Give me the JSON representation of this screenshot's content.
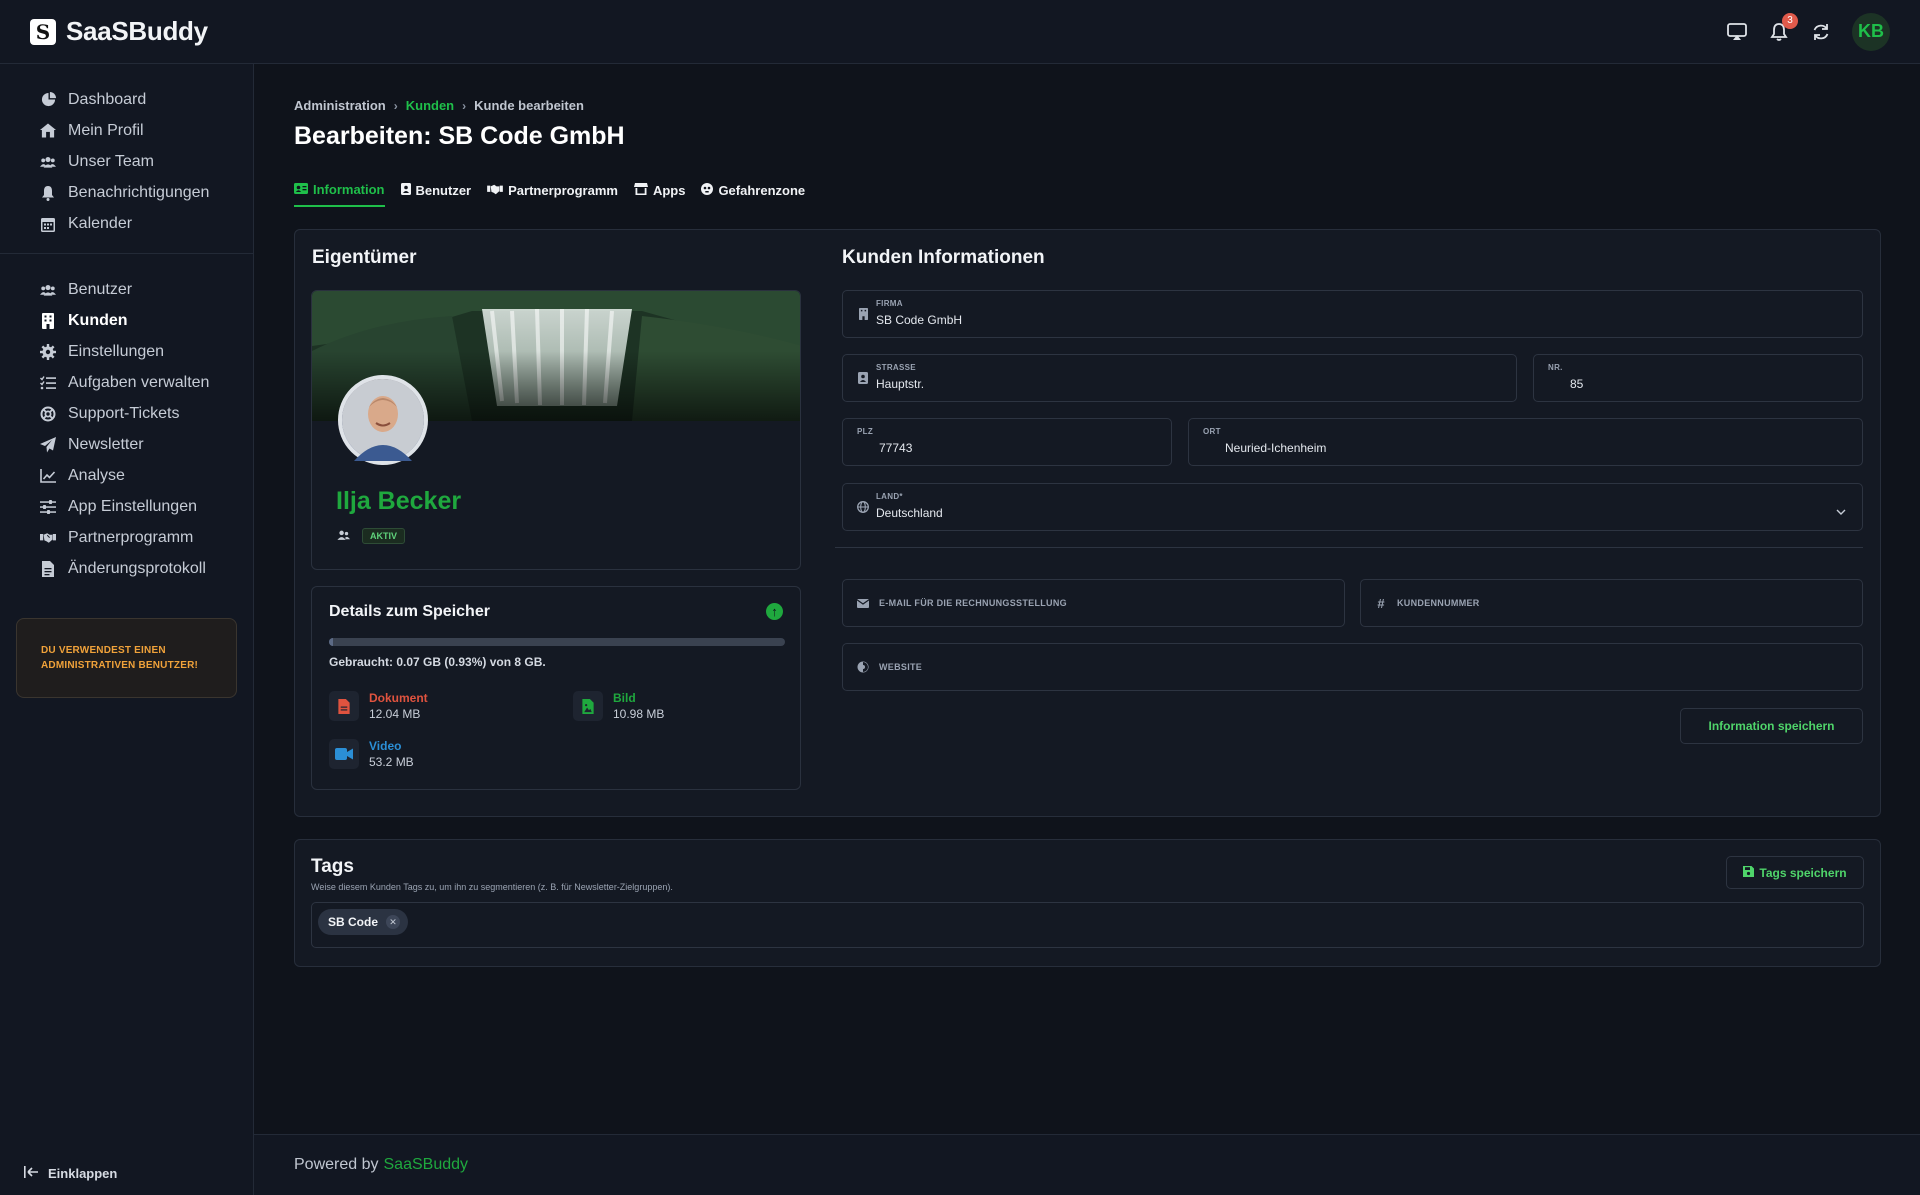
{
  "header": {
    "brand": "SaaSBuddy",
    "brand_logo_letter": "S",
    "notification_count": "3",
    "user_initials": "KB"
  },
  "sidebar": {
    "group1": [
      {
        "label": "Dashboard",
        "icon": "chart-pie-icon"
      },
      {
        "label": "Mein Profil",
        "icon": "home-icon"
      },
      {
        "label": "Unser Team",
        "icon": "users-icon"
      },
      {
        "label": "Benachrichtigungen",
        "icon": "bell-icon"
      },
      {
        "label": "Kalender",
        "icon": "calendar-icon"
      }
    ],
    "group2": [
      {
        "label": "Benutzer",
        "icon": "users-icon"
      },
      {
        "label": "Kunden",
        "icon": "building-icon",
        "active": true
      },
      {
        "label": "Einstellungen",
        "icon": "gear-icon"
      },
      {
        "label": "Aufgaben verwalten",
        "icon": "list-check-icon"
      },
      {
        "label": "Support-Tickets",
        "icon": "lifebuoy-icon"
      },
      {
        "label": "Newsletter",
        "icon": "paper-plane-icon"
      },
      {
        "label": "Analyse",
        "icon": "chart-line-icon"
      },
      {
        "label": "App Einstellungen",
        "icon": "sliders-icon"
      },
      {
        "label": "Partnerprogramm",
        "icon": "handshake-icon"
      },
      {
        "label": "Änderungsprotokoll",
        "icon": "file-icon"
      }
    ],
    "admin_warning": "DU VERWENDEST EINEN ADMINISTRATIVEN BENUTZER!",
    "collapse_label": "Einklappen"
  },
  "breadcrumb": {
    "root": "Administration",
    "middle": "Kunden",
    "current": "Kunde bearbeiten"
  },
  "page_title": "Bearbeiten: SB Code GmbH",
  "tabs": [
    {
      "label": "Information",
      "icon": "id-card-icon",
      "active": true
    },
    {
      "label": "Benutzer",
      "icon": "user-card-icon"
    },
    {
      "label": "Partnerprogramm",
      "icon": "handshake-icon"
    },
    {
      "label": "Apps",
      "icon": "store-icon"
    },
    {
      "label": "Gefahrenzone",
      "icon": "skull-icon"
    }
  ],
  "owner": {
    "section_title": "Eigentümer",
    "name": "Ilja Becker",
    "status": "AKTIV"
  },
  "storage": {
    "title": "Details zum Speicher",
    "used_text": "Gebraucht: 0.07 GB (0.93%) von 8 GB.",
    "used_fraction": 0.0093,
    "files": [
      {
        "label": "Dokument",
        "size": "12.04 MB",
        "color": "#e0533f",
        "icon": "file-icon"
      },
      {
        "label": "Bild",
        "size": "10.98 MB",
        "color": "#1fa83e",
        "icon": "image-file-icon"
      },
      {
        "label": "Video",
        "size": "53.2 MB",
        "color": "#2b8fd6",
        "icon": "video-icon"
      }
    ]
  },
  "customer": {
    "section_title": "Kunden Informationen",
    "firma_label": "FIRMA",
    "firma_value": "SB Code GmbH",
    "strasse_label": "STRASSE",
    "strasse_value": "Hauptstr.",
    "nr_label": "NR.",
    "nr_value": "85",
    "plz_label": "PLZ",
    "plz_value": "77743",
    "ort_label": "ORT",
    "ort_value": "Neuried-Ichenheim",
    "land_label": "LAND*",
    "land_value": "Deutschland",
    "email_label": "E-MAIL FÜR DIE RECHNUNGSSTELLUNG",
    "kundennr_label": "KUNDENNUMMER",
    "website_label": "WEBSITE",
    "save_button": "Information speichern"
  },
  "tags": {
    "title": "Tags",
    "subtitle": "Weise diesem Kunden Tags zu, um ihn zu segmentieren (z. B. für Newsletter-Zielgruppen).",
    "save_button": "Tags speichern",
    "items": [
      "SB Code"
    ]
  },
  "footer": {
    "prefix": "Powered by",
    "brand": "SaaSBuddy"
  },
  "colors": {
    "accent": "#1fbf4a",
    "background": "#0f131b",
    "warning": "#f0a23a"
  }
}
